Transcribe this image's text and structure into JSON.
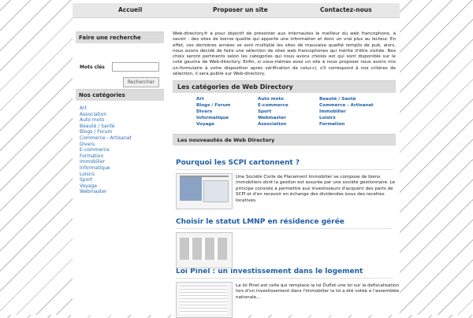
{
  "nav": {
    "items": [
      "Accueil",
      "Proposer un site",
      "Contactez-nous"
    ]
  },
  "search": {
    "heading": "Faire une recherche",
    "label": "Mots clés",
    "button": "Rechercher"
  },
  "categories_box": {
    "heading": "Nos catégories",
    "items": [
      "Art",
      "Association",
      "Auto moto",
      "Beauté / Santé",
      "Blogs / Forum",
      "Commerce - Artisanat",
      "Divers",
      "E-commerce",
      "Formation",
      "Immobilier",
      "Informatique",
      "Loisirs",
      "Sport",
      "Voyage",
      "Webmaster"
    ]
  },
  "intro": {
    "text": "Web-directory.fr à pour objectif de présenter aux internautes le meilleur du web francophone, à savoir : des sites de bonne qualité qui apporte une information et donc un vrai plus au lecteur. En effet, ces dernières années se sont multiplié les sites de mauvaise qualité remplis de pub, alors, nous avons décidé de faire une sélection de sites web francophones qui mérite d'être visitée. Nos choix seront pertinents selon les catégories qui nous avons choisis est qui sont disponible sur le coté gauche de Web-directory. Enfin, si vous-mêmes avez un site à nous proposer nous avons mis un-formulaire à votre disposition après vérification de celui-ci, s'il correspond à nos critères de sélection, il sera publié sur Web-directory."
  },
  "categories_section": {
    "heading": "Les catégories de Web Directory",
    "columns": [
      [
        "Art",
        "Blogs / Forum",
        "Divers",
        "Informatique",
        "Voyage"
      ],
      [
        "Auto moto",
        "E-commerce",
        "Sport",
        "Webmaster",
        "Association"
      ],
      [
        "Beauté / Santé",
        "Commerce - Artisanat",
        "Immobilier",
        "Loisirs",
        "Formation"
      ]
    ]
  },
  "news": {
    "heading": "Les nouveautés de Web Directory",
    "articles": [
      {
        "title": "Pourquoi les SCPI cartonnent ?",
        "text": "Une Société Civile de Placement Immobilier se compose de biens immobiliers dont la gestion est assurée par une société gestionnaire. Le principe consiste à permettre aux investisseurs d'acquérir des parts de SCPI et d'en recevoir en échange des dividendes issus des recettes locatives."
      },
      {
        "title": "Choisir le statut LMNP en résidence gérée",
        "text": ""
      },
      {
        "title": "Loi Pinel : un investissement dans le logement",
        "text": "La loi Pinel est celle qui remplace la loi Duflot une loi sur la defiscalisation lors d'un investissement dans l'immobilier la loi a été votée a l'assemblée nationale..."
      }
    ]
  }
}
